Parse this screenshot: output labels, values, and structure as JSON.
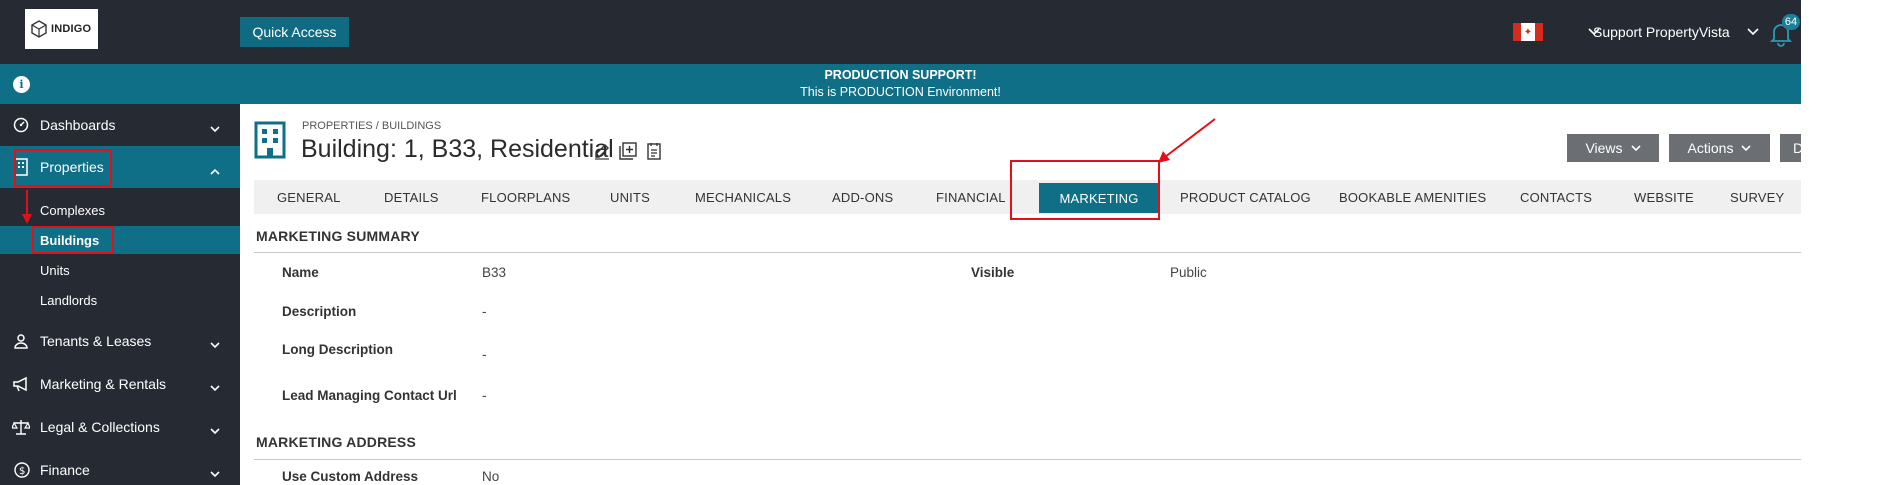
{
  "header": {
    "logo_text": "INDIGO",
    "quick_access": "Quick Access",
    "user": "Support PropertyVista",
    "notification_count": "64",
    "flag": "canada-flag-icon"
  },
  "banner": {
    "title": "PRODUCTION SUPPORT!",
    "subtitle": "This is PRODUCTION Environment!",
    "info_glyph": "i"
  },
  "sidebar": {
    "items": [
      {
        "label": "Dashboards",
        "icon": "dashboard-icon"
      },
      {
        "label": "Properties",
        "icon": "building-icon"
      },
      {
        "label": "Tenants & Leases",
        "icon": "person-icon"
      },
      {
        "label": "Marketing & Rentals",
        "icon": "megaphone-icon"
      },
      {
        "label": "Legal & Collections",
        "icon": "scales-icon"
      },
      {
        "label": "Finance",
        "icon": "money-icon"
      }
    ],
    "sub_items": [
      {
        "label": "Complexes"
      },
      {
        "label": "Buildings"
      },
      {
        "label": "Units"
      },
      {
        "label": "Landlords"
      }
    ]
  },
  "page": {
    "breadcrumb": "PROPERTIES / BUILDINGS",
    "title": "Building: 1, B33, Residential",
    "buttons": {
      "views": "Views",
      "actions": "Actions",
      "partial": "D"
    }
  },
  "tabs": [
    {
      "label": "GENERAL"
    },
    {
      "label": "DETAILS"
    },
    {
      "label": "FLOORPLANS"
    },
    {
      "label": "UNITS"
    },
    {
      "label": "MECHANICALS"
    },
    {
      "label": "ADD-ONS"
    },
    {
      "label": "FINANCIAL"
    },
    {
      "label": "MARKETING"
    },
    {
      "label": "PRODUCT CATALOG"
    },
    {
      "label": "BOOKABLE AMENITIES"
    },
    {
      "label": "CONTACTS"
    },
    {
      "label": "WEBSITE"
    },
    {
      "label": "SURVEY"
    }
  ],
  "marketing_summary": {
    "title": "MARKETING SUMMARY",
    "fields": {
      "name": {
        "label": "Name",
        "value": "B33"
      },
      "visible": {
        "label": "Visible",
        "value": "Public"
      },
      "description": {
        "label": "Description",
        "value": "-"
      },
      "long_description": {
        "label": "Long Description",
        "value": "-"
      },
      "lead_url": {
        "label": "Lead Managing Contact Url",
        "value": "-"
      }
    }
  },
  "marketing_address": {
    "title": "MARKETING ADDRESS",
    "fields": {
      "use_custom": {
        "label": "Use Custom Address",
        "value": "No"
      }
    }
  },
  "colors": {
    "teal": "#0f6f86",
    "dark": "#262b33",
    "highlight_red": "#e2101a"
  }
}
